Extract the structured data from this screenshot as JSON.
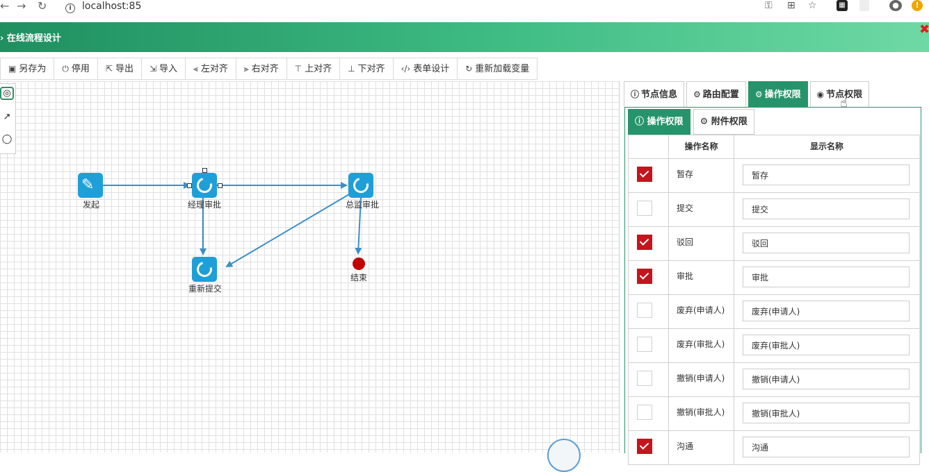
{
  "browser": {
    "url": "localhost:85"
  },
  "titlebar": {
    "title": "› 在线流程设计",
    "close_glyph": "✖"
  },
  "toolbar": {
    "buttons": [
      {
        "label": "另存为",
        "icon": "save-icon",
        "glyph": "▣"
      },
      {
        "label": "停用",
        "icon": "power-icon",
        "glyph": "⏻"
      },
      {
        "label": "导出",
        "icon": "export-icon",
        "glyph": "⇱"
      },
      {
        "label": "导入",
        "icon": "import-icon",
        "glyph": "⇲"
      },
      {
        "label": "左对齐",
        "icon": "align-left-icon",
        "glyph": "⫷"
      },
      {
        "label": "右对齐",
        "icon": "align-right-icon",
        "glyph": "⫸"
      },
      {
        "label": "上对齐",
        "icon": "align-top-icon",
        "glyph": "⊤"
      },
      {
        "label": "下对齐",
        "icon": "align-bottom-icon",
        "glyph": "⊥"
      },
      {
        "label": "表单设计",
        "icon": "code-icon",
        "glyph": "‹/›"
      },
      {
        "label": "重新加载变量",
        "icon": "reload-icon",
        "glyph": "↻"
      }
    ]
  },
  "flow": {
    "nodes": [
      {
        "id": "start",
        "label": "发起",
        "type": "start"
      },
      {
        "id": "manager",
        "label": "经理审批",
        "type": "task"
      },
      {
        "id": "director",
        "label": "总监审批",
        "type": "task"
      },
      {
        "id": "resubmit",
        "label": "重新提交",
        "type": "task"
      },
      {
        "id": "end",
        "label": "结束",
        "type": "end"
      }
    ],
    "colors": {
      "node": "#1f9fd8",
      "line": "#3a8fc9",
      "end": "#c10000"
    }
  },
  "panel": {
    "tabs": [
      {
        "label": "节点信息",
        "icon": "info-icon",
        "glyph": "ⓘ",
        "active": false
      },
      {
        "label": "路由配置",
        "icon": "gear-icon",
        "glyph": "⚙",
        "active": false
      },
      {
        "label": "操作权限",
        "icon": "gear-icon",
        "glyph": "⚙",
        "active": true
      },
      {
        "label": "节点权限",
        "icon": "eye-icon",
        "glyph": "◉",
        "active": false
      }
    ],
    "subtabs": [
      {
        "label": "操作权限",
        "icon": "info-icon",
        "glyph": "ⓘ",
        "active": true
      },
      {
        "label": "附件权限",
        "icon": "gear-icon",
        "glyph": "⚙",
        "active": false
      }
    ],
    "columns": {
      "name": "操作名称",
      "display": "显示名称"
    },
    "rows": [
      {
        "checked": true,
        "name": "暂存",
        "display": "暂存"
      },
      {
        "checked": false,
        "name": "提交",
        "display": "提交"
      },
      {
        "checked": true,
        "name": "驳回",
        "display": "驳回"
      },
      {
        "checked": true,
        "name": "审批",
        "display": "审批"
      },
      {
        "checked": false,
        "name": "废弃(申请人)",
        "display": "废弃(申请人)"
      },
      {
        "checked": false,
        "name": "废弃(审批人)",
        "display": "废弃(审批人)"
      },
      {
        "checked": false,
        "name": "撤销(申请人)",
        "display": "撤销(申请人)"
      },
      {
        "checked": false,
        "name": "撤销(审批人)",
        "display": "撤销(审批人)"
      },
      {
        "checked": true,
        "name": "沟通",
        "display": "沟通"
      }
    ],
    "accent": "#26946a",
    "check_color": "#c4141c"
  }
}
